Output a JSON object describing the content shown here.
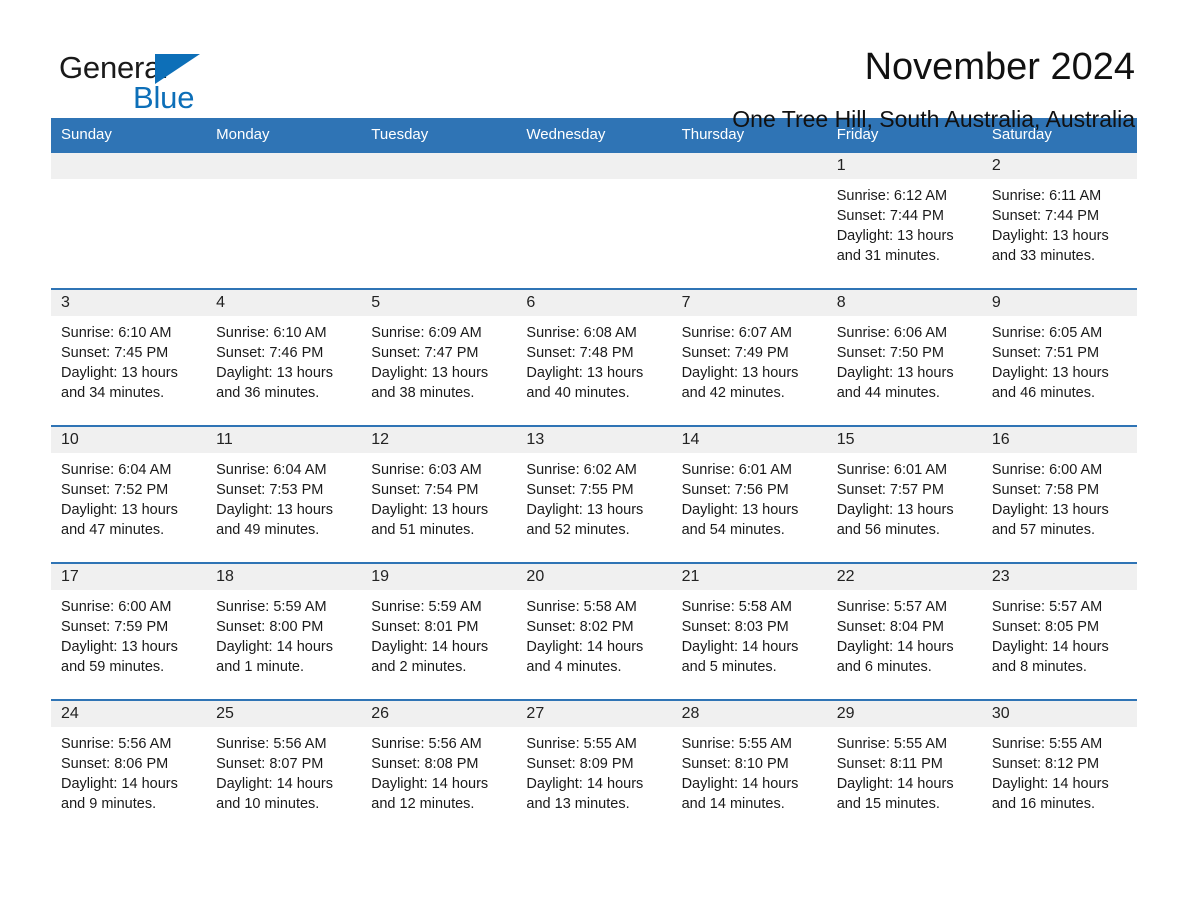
{
  "brand": {
    "name_primary": "General",
    "name_secondary": "Blue",
    "accent_color": "#0d6fb8"
  },
  "header": {
    "title": "November 2024",
    "subtitle": "One Tree Hill, South Australia, Australia"
  },
  "theme": {
    "header_bg": "#2f74b5",
    "daynum_bg": "#f0f0f0",
    "row_rule": "#2f74b5"
  },
  "weekday_headers": [
    "Sunday",
    "Monday",
    "Tuesday",
    "Wednesday",
    "Thursday",
    "Friday",
    "Saturday"
  ],
  "weeks": [
    [
      {
        "day": "",
        "lines": []
      },
      {
        "day": "",
        "lines": []
      },
      {
        "day": "",
        "lines": []
      },
      {
        "day": "",
        "lines": []
      },
      {
        "day": "",
        "lines": []
      },
      {
        "day": "1",
        "lines": [
          "Sunrise: 6:12 AM",
          "Sunset: 7:44 PM",
          "Daylight: 13 hours",
          "and 31 minutes."
        ]
      },
      {
        "day": "2",
        "lines": [
          "Sunrise: 6:11 AM",
          "Sunset: 7:44 PM",
          "Daylight: 13 hours",
          "and 33 minutes."
        ]
      }
    ],
    [
      {
        "day": "3",
        "lines": [
          "Sunrise: 6:10 AM",
          "Sunset: 7:45 PM",
          "Daylight: 13 hours",
          "and 34 minutes."
        ]
      },
      {
        "day": "4",
        "lines": [
          "Sunrise: 6:10 AM",
          "Sunset: 7:46 PM",
          "Daylight: 13 hours",
          "and 36 minutes."
        ]
      },
      {
        "day": "5",
        "lines": [
          "Sunrise: 6:09 AM",
          "Sunset: 7:47 PM",
          "Daylight: 13 hours",
          "and 38 minutes."
        ]
      },
      {
        "day": "6",
        "lines": [
          "Sunrise: 6:08 AM",
          "Sunset: 7:48 PM",
          "Daylight: 13 hours",
          "and 40 minutes."
        ]
      },
      {
        "day": "7",
        "lines": [
          "Sunrise: 6:07 AM",
          "Sunset: 7:49 PM",
          "Daylight: 13 hours",
          "and 42 minutes."
        ]
      },
      {
        "day": "8",
        "lines": [
          "Sunrise: 6:06 AM",
          "Sunset: 7:50 PM",
          "Daylight: 13 hours",
          "and 44 minutes."
        ]
      },
      {
        "day": "9",
        "lines": [
          "Sunrise: 6:05 AM",
          "Sunset: 7:51 PM",
          "Daylight: 13 hours",
          "and 46 minutes."
        ]
      }
    ],
    [
      {
        "day": "10",
        "lines": [
          "Sunrise: 6:04 AM",
          "Sunset: 7:52 PM",
          "Daylight: 13 hours",
          "and 47 minutes."
        ]
      },
      {
        "day": "11",
        "lines": [
          "Sunrise: 6:04 AM",
          "Sunset: 7:53 PM",
          "Daylight: 13 hours",
          "and 49 minutes."
        ]
      },
      {
        "day": "12",
        "lines": [
          "Sunrise: 6:03 AM",
          "Sunset: 7:54 PM",
          "Daylight: 13 hours",
          "and 51 minutes."
        ]
      },
      {
        "day": "13",
        "lines": [
          "Sunrise: 6:02 AM",
          "Sunset: 7:55 PM",
          "Daylight: 13 hours",
          "and 52 minutes."
        ]
      },
      {
        "day": "14",
        "lines": [
          "Sunrise: 6:01 AM",
          "Sunset: 7:56 PM",
          "Daylight: 13 hours",
          "and 54 minutes."
        ]
      },
      {
        "day": "15",
        "lines": [
          "Sunrise: 6:01 AM",
          "Sunset: 7:57 PM",
          "Daylight: 13 hours",
          "and 56 minutes."
        ]
      },
      {
        "day": "16",
        "lines": [
          "Sunrise: 6:00 AM",
          "Sunset: 7:58 PM",
          "Daylight: 13 hours",
          "and 57 minutes."
        ]
      }
    ],
    [
      {
        "day": "17",
        "lines": [
          "Sunrise: 6:00 AM",
          "Sunset: 7:59 PM",
          "Daylight: 13 hours",
          "and 59 minutes."
        ]
      },
      {
        "day": "18",
        "lines": [
          "Sunrise: 5:59 AM",
          "Sunset: 8:00 PM",
          "Daylight: 14 hours",
          "and 1 minute."
        ]
      },
      {
        "day": "19",
        "lines": [
          "Sunrise: 5:59 AM",
          "Sunset: 8:01 PM",
          "Daylight: 14 hours",
          "and 2 minutes."
        ]
      },
      {
        "day": "20",
        "lines": [
          "Sunrise: 5:58 AM",
          "Sunset: 8:02 PM",
          "Daylight: 14 hours",
          "and 4 minutes."
        ]
      },
      {
        "day": "21",
        "lines": [
          "Sunrise: 5:58 AM",
          "Sunset: 8:03 PM",
          "Daylight: 14 hours",
          "and 5 minutes."
        ]
      },
      {
        "day": "22",
        "lines": [
          "Sunrise: 5:57 AM",
          "Sunset: 8:04 PM",
          "Daylight: 14 hours",
          "and 6 minutes."
        ]
      },
      {
        "day": "23",
        "lines": [
          "Sunrise: 5:57 AM",
          "Sunset: 8:05 PM",
          "Daylight: 14 hours",
          "and 8 minutes."
        ]
      }
    ],
    [
      {
        "day": "24",
        "lines": [
          "Sunrise: 5:56 AM",
          "Sunset: 8:06 PM",
          "Daylight: 14 hours",
          "and 9 minutes."
        ]
      },
      {
        "day": "25",
        "lines": [
          "Sunrise: 5:56 AM",
          "Sunset: 8:07 PM",
          "Daylight: 14 hours",
          "and 10 minutes."
        ]
      },
      {
        "day": "26",
        "lines": [
          "Sunrise: 5:56 AM",
          "Sunset: 8:08 PM",
          "Daylight: 14 hours",
          "and 12 minutes."
        ]
      },
      {
        "day": "27",
        "lines": [
          "Sunrise: 5:55 AM",
          "Sunset: 8:09 PM",
          "Daylight: 14 hours",
          "and 13 minutes."
        ]
      },
      {
        "day": "28",
        "lines": [
          "Sunrise: 5:55 AM",
          "Sunset: 8:10 PM",
          "Daylight: 14 hours",
          "and 14 minutes."
        ]
      },
      {
        "day": "29",
        "lines": [
          "Sunrise: 5:55 AM",
          "Sunset: 8:11 PM",
          "Daylight: 14 hours",
          "and 15 minutes."
        ]
      },
      {
        "day": "30",
        "lines": [
          "Sunrise: 5:55 AM",
          "Sunset: 8:12 PM",
          "Daylight: 14 hours",
          "and 16 minutes."
        ]
      }
    ]
  ]
}
